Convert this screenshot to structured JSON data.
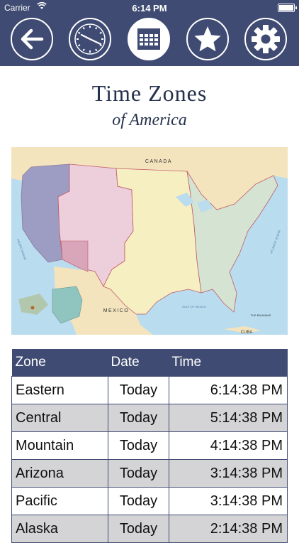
{
  "status_bar": {
    "carrier": "Carrier",
    "time": "6:14 PM"
  },
  "nav": {
    "items": [
      {
        "icon": "back-arrow-icon",
        "active": false
      },
      {
        "icon": "clock-icon",
        "active": false
      },
      {
        "icon": "calendar-icon",
        "active": true
      },
      {
        "icon": "star-icon",
        "active": false
      },
      {
        "icon": "gear-icon",
        "active": false
      }
    ]
  },
  "page": {
    "title": "Time Zones",
    "subtitle": "of America"
  },
  "map": {
    "labels": {
      "canada": "CANADA",
      "mexico": "MEXICO",
      "cuba": "CUBA",
      "bahamas": "THE BAHAMAS",
      "pacific_ocean": "PACIFIC OCEAN",
      "atlantic_ocean": "ATLANTIC OCEAN",
      "gulf": "GULF OF MEXICO"
    },
    "zone_colors": {
      "pacific": "#9d9cc2",
      "mountain": "#eccfdb",
      "central": "#f6efc1",
      "eastern": "#d5e3d2",
      "alaska_hawaii": "#8fc4bf",
      "arizona": "#d9a5b9"
    }
  },
  "table": {
    "headers": {
      "zone": "Zone",
      "date": "Date",
      "time": "Time"
    },
    "rows": [
      {
        "zone": "Eastern",
        "date": "Today",
        "time": "6:14:38 PM"
      },
      {
        "zone": "Central",
        "date": "Today",
        "time": "5:14:38 PM"
      },
      {
        "zone": "Mountain",
        "date": "Today",
        "time": "4:14:38 PM"
      },
      {
        "zone": "Arizona",
        "date": "Today",
        "time": "3:14:38 PM"
      },
      {
        "zone": "Pacific",
        "date": "Today",
        "time": "3:14:38 PM"
      },
      {
        "zone": "Alaska",
        "date": "Today",
        "time": "2:14:38 PM"
      }
    ]
  },
  "colors": {
    "header_bg": "#3f4b72",
    "title_text": "#26314d",
    "row_alt": "#d4d4d6"
  }
}
